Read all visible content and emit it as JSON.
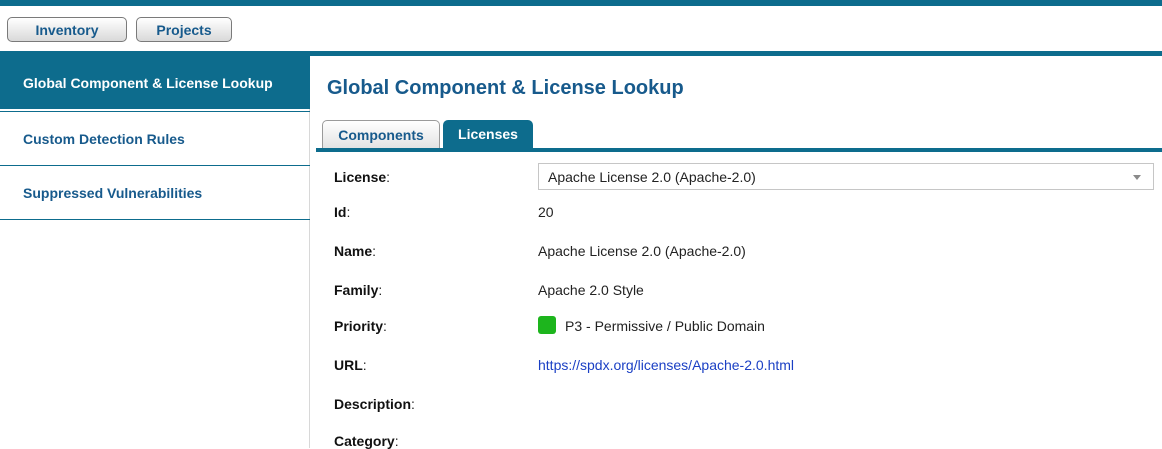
{
  "top_nav": {
    "inventory_label": "Inventory",
    "projects_label": "Projects"
  },
  "sidebar": {
    "items": [
      {
        "label": "Global Component & License Lookup",
        "active": true
      },
      {
        "label": "Custom Detection Rules",
        "active": false
      },
      {
        "label": "Suppressed Vulnerabilities",
        "active": false
      }
    ]
  },
  "main": {
    "title": "Global Component & License Lookup",
    "tabs": [
      {
        "label": "Components",
        "selected": false
      },
      {
        "label": "Licenses",
        "selected": true
      }
    ]
  },
  "details": {
    "license": {
      "label": "License",
      "colon": ":",
      "value": "Apache License 2.0 (Apache-2.0)"
    },
    "id": {
      "label": "Id",
      "colon": ":",
      "value": "20"
    },
    "name": {
      "label": "Name",
      "colon": ":",
      "value": "Apache License 2.0 (Apache-2.0)"
    },
    "family": {
      "label": "Family",
      "colon": ":",
      "value": "Apache 2.0 Style"
    },
    "priority": {
      "label": "Priority",
      "colon": ":",
      "value": "P3 - Permissive / Public Domain",
      "color": "#1db51d"
    },
    "url": {
      "label": "URL",
      "colon": ":",
      "value": "https://spdx.org/licenses/Apache-2.0.html"
    },
    "description": {
      "label": "Description",
      "colon": ":"
    },
    "category": {
      "label": "Category",
      "colon": ":"
    }
  },
  "colors": {
    "brand": "#0d6c8d",
    "link": "#1a3fc4",
    "priority_p3": "#1db51d"
  },
  "icons": {
    "select_arrow": "chevron-down-icon",
    "priority_swatch": "priority-color-swatch"
  }
}
